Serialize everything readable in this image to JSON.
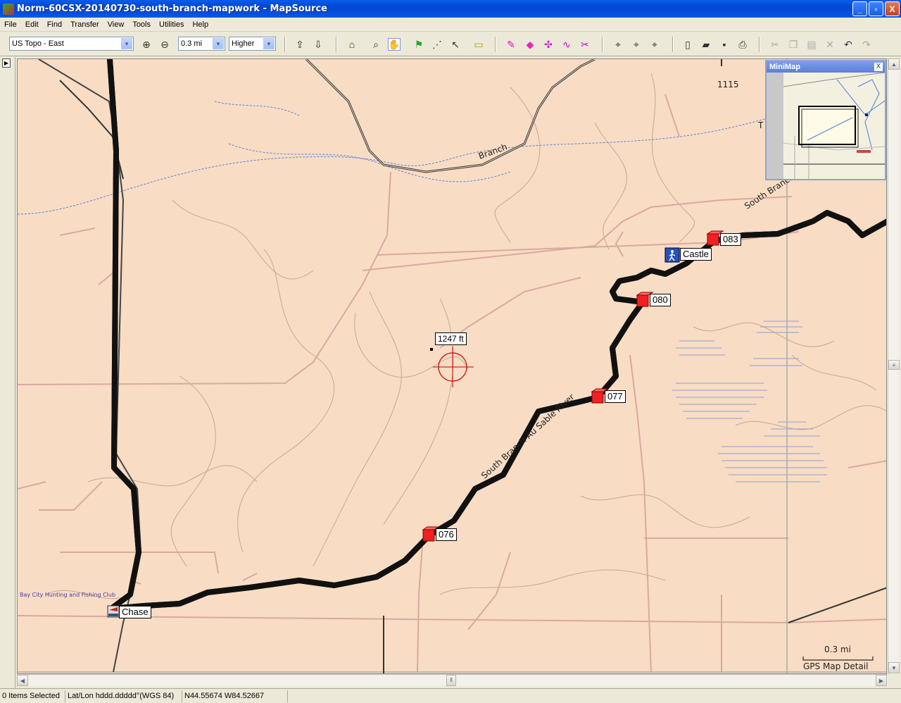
{
  "window": {
    "title": "Norm-60CSX-20140730-south-branch-mapwork - MapSource",
    "min_label": "_",
    "max_label": "▫",
    "close_label": "X"
  },
  "menu": [
    "File",
    "Edit",
    "Find",
    "Transfer",
    "View",
    "Tools",
    "Utilities",
    "Help"
  ],
  "toolbar": {
    "map_product": "US Topo - East",
    "zoom_level": "0.3 mi",
    "detail": "Higher",
    "icons": [
      "receive-from-device-icon",
      "send-to-device-icon",
      "map-tool-icon",
      "zoom-tool-icon",
      "hand-tool-icon",
      "waypoint-tool-icon",
      "route-tool-icon",
      "selection-tool-icon",
      "distance-tool-icon",
      "track-draw-icon",
      "eraser-icon",
      "track-edit-icon",
      "track-join-icon",
      "track-divide-icon",
      "find-icon",
      "find-places-icon",
      "find-recent-icon",
      "new-icon",
      "open-icon",
      "save-icon",
      "print-icon",
      "cut-icon",
      "copy-icon",
      "paste-icon",
      "delete-icon",
      "undo-icon",
      "redo-icon"
    ]
  },
  "map": {
    "labels": {
      "road_1115": "1115",
      "branch": "Branch",
      "t_label": "T",
      "river_north": "South Branch Au Sable River",
      "river_south": "South Branch Au Sable River",
      "club": "Bay City Hunting and Fishing Club"
    },
    "elevation_tooltip": "1247 ft",
    "waypoints": [
      {
        "name": "083",
        "type": "geocache"
      },
      {
        "name": "Castle",
        "type": "trailhead"
      },
      {
        "name": "080",
        "type": "geocache"
      },
      {
        "name": "077",
        "type": "geocache"
      },
      {
        "name": "076",
        "type": "geocache"
      },
      {
        "name": "Chase",
        "type": "boat-ramp"
      }
    ],
    "scale_label": "0.3 mi",
    "detail_label": "GPS Map Detail"
  },
  "minimap": {
    "title": "MiniMap",
    "close": "X"
  },
  "status": {
    "selected": "0 Items Selected",
    "format": "Lat/Lon hddd.ddddd°(WGS 84)",
    "coordinates": "N44.55674 W84.52667"
  },
  "colors": {
    "map_bg": "#f8dcc4",
    "track_green": "#22e022",
    "road_pink": "#d8a8a0",
    "road_dark": "#333333",
    "water_blue": "#4d78d6"
  }
}
